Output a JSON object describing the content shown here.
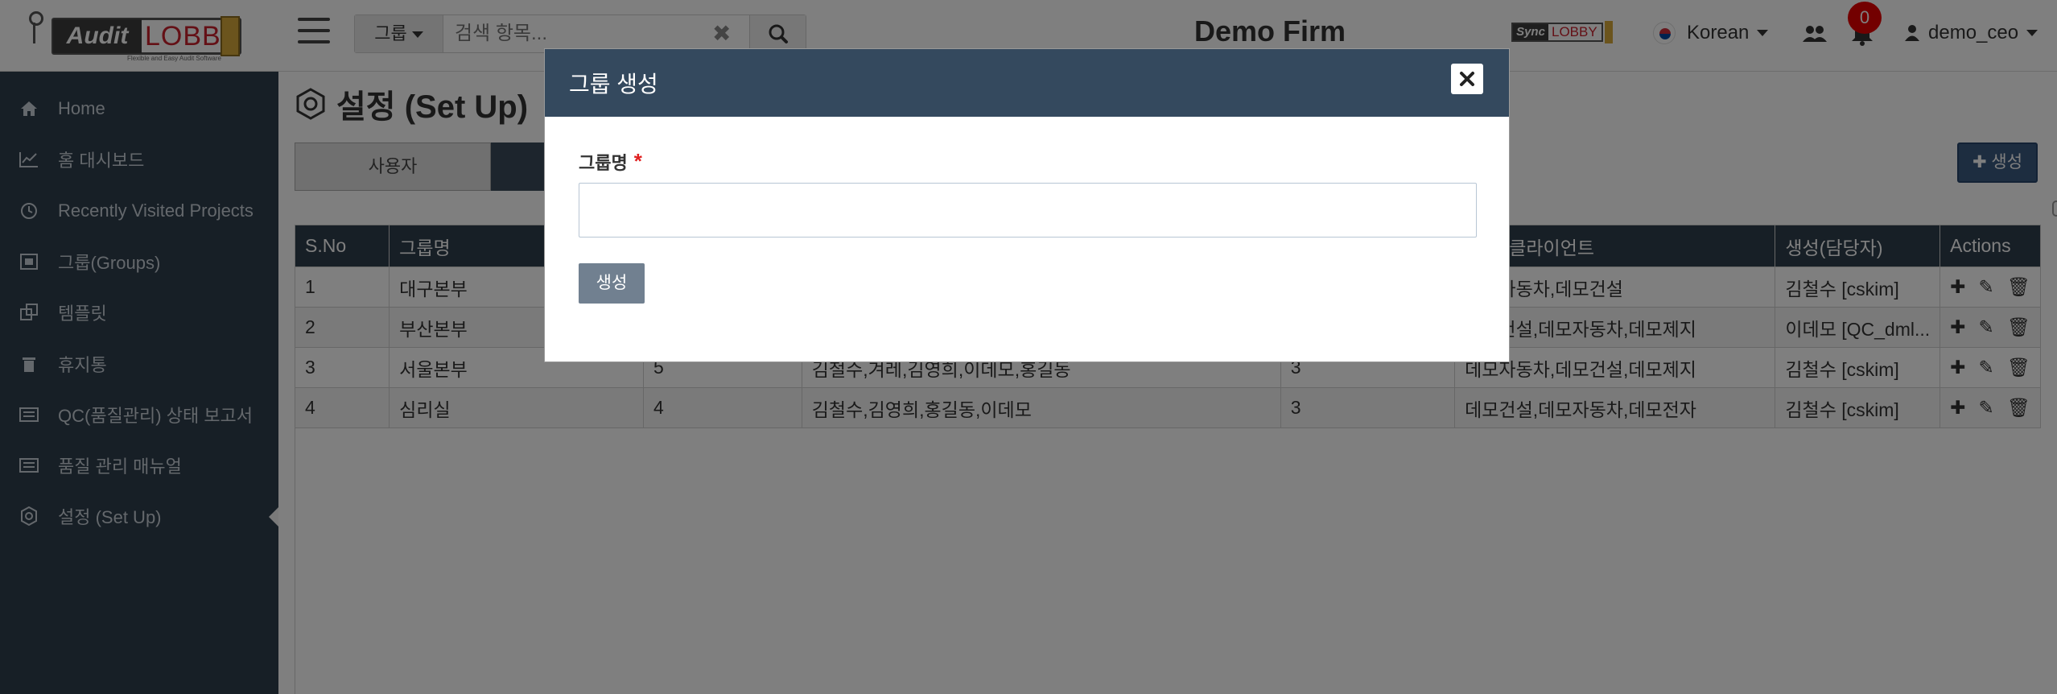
{
  "header": {
    "logo_text_1": "Audit",
    "logo_text_2": "LOBBY",
    "logo_tagline": "Flexible and Easy Audit Software",
    "search_dropdown": "그룹",
    "search_placeholder": "검색 항목...",
    "firm_name": "Demo Firm",
    "sync_logo_1": "Sync",
    "sync_logo_2": "LOBBY",
    "language": "Korean",
    "notification_count": "0",
    "user_name": "demo_ceo"
  },
  "sidebar": {
    "items": [
      {
        "label": "Home",
        "icon": "home-icon"
      },
      {
        "label": "홈 대시보드",
        "icon": "chart-line-icon"
      },
      {
        "label": "Recently Visited Projects",
        "icon": "clock-icon"
      },
      {
        "label": "그룹(Groups)",
        "icon": "group-icon"
      },
      {
        "label": "템플릿",
        "icon": "template-icon"
      },
      {
        "label": "휴지통",
        "icon": "trash-icon"
      },
      {
        "label": "QC(품질관리) 상태 보고서",
        "icon": "report-icon"
      },
      {
        "label": "품질 관리 매뉴얼",
        "icon": "manual-icon"
      },
      {
        "label": "설정 (Set Up)",
        "icon": "setup-icon"
      }
    ]
  },
  "main": {
    "title": "설정 (Set Up)",
    "tab_user": "사용자",
    "create_button": "생성",
    "table": {
      "headers": [
        "S.No",
        "그룹명",
        "",
        "",
        "",
        "정 된 클라이언트",
        "생성(담당자)",
        "Actions"
      ],
      "rows": [
        [
          "1",
          "대구본부",
          "",
          "",
          "",
          "데모자동차,데모건설",
          "김철수 [cskim]"
        ],
        [
          "2",
          "부산본부",
          "",
          "",
          "",
          "데모건설,데모자동차,데모제지",
          "이데모 [QC_dml..."
        ],
        [
          "3",
          "서울본부",
          "5",
          "김철수,겨레,김영희,이데모,홍길동",
          "3",
          "데모자동차,데모건설,데모제지",
          "김철수 [cskim]"
        ],
        [
          "4",
          "심리실",
          "4",
          "김철수,김영희,홍길동,이데모",
          "3",
          "데모건설,데모자동차,데모전자",
          "김철수 [cskim]"
        ]
      ]
    }
  },
  "modal": {
    "title": "그룹 생성",
    "field_label": "그룹명",
    "required_mark": "*",
    "input_value": "",
    "submit_label": "생성"
  },
  "colors": {
    "sidebar_bg": "#2f3e4d",
    "modal_header": "#34495e",
    "badge_red": "#e60000",
    "required_red": "#e02020"
  }
}
